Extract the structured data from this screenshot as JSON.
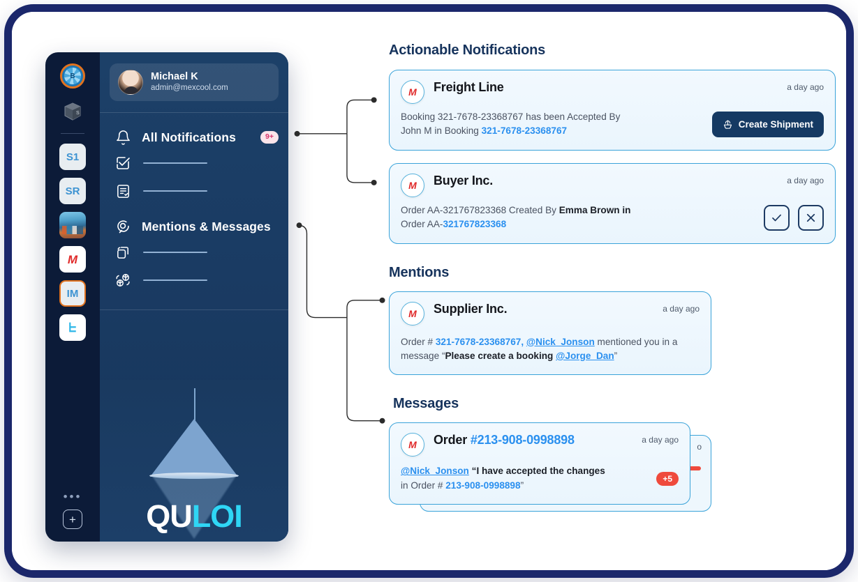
{
  "sidebar": {
    "rail": {
      "logo_icon": "quloi-rail-logo-icon",
      "logo_letter": "B",
      "box_icon": "package-box-icon",
      "tiles": [
        {
          "label": "S1",
          "name": "rail-tile-s1"
        },
        {
          "label": "SR",
          "name": "rail-tile-sr"
        },
        {
          "label": "",
          "name": "rail-tile-port-photo"
        },
        {
          "label": "M",
          "name": "rail-tile-m-logo"
        },
        {
          "label": "IM",
          "name": "rail-tile-im"
        },
        {
          "label": "P",
          "name": "rail-tile-p-logo"
        }
      ],
      "more_dots": "•••",
      "add_label": "+"
    },
    "profile": {
      "name": "Michael K",
      "email": "admin@mexcool.com"
    },
    "menu": {
      "all_notifications": {
        "label": "All Notifications",
        "badge": "9+",
        "icon": "bell-icon"
      },
      "sub_items_1": [
        {
          "icon": "check-square-icon"
        },
        {
          "icon": "document-check-icon"
        }
      ],
      "mentions_messages": {
        "label": "Mentions & Messages",
        "icon": "chat-bubble-icon"
      },
      "sub_items_2": [
        {
          "icon": "copy-pages-icon"
        },
        {
          "icon": "cube-refresh-icon"
        }
      ]
    },
    "brand": {
      "word_part1": "QU",
      "word_part2": "LOI",
      "lamp_icon": "pendant-lamp-icon"
    }
  },
  "content": {
    "sections": {
      "actionable": "Actionable Notifications",
      "mentions": "Mentions",
      "messages": "Messages"
    },
    "actionable_cards": [
      {
        "avatar_icon": "company-m-logo-icon",
        "title": "Freight Line",
        "time": "a day ago",
        "text_line1_pre": "Booking 321-7678-23368767 has been Accepted By",
        "text_line2_pre": "John M in Booking ",
        "text_line2_link": "321-7678-23368767",
        "action_button": "Create Shipment",
        "action_button_icon": "ship-icon"
      },
      {
        "avatar_icon": "company-m-logo-icon",
        "title": "Buyer Inc.",
        "time": "a day ago",
        "text_line1_pre": "Order AA-321767823368 Created By ",
        "text_line1_bold": "Emma Brown in",
        "text_line2_pre": "Order AA-",
        "text_line2_link": "321767823368",
        "accept_icon": "check-icon",
        "reject_icon": "close-x-icon"
      }
    ],
    "mention_card": {
      "avatar_icon": "company-m-logo-icon",
      "title": "Supplier Inc.",
      "time": "a day ago",
      "text_pre": "Order # ",
      "order_link": "321-7678-23368767,",
      "user_link": "@Nick_Jonson",
      "text_mid": " mentioned you in a message ",
      "quote_open": "“",
      "quote_bold": "Please create a booking ",
      "quote_link": "@Jorge_Dan",
      "quote_close": "”"
    },
    "message_card": {
      "avatar_icon": "company-m-logo-icon",
      "title_prefix": "Order ",
      "title_order": "#213-908-0998898",
      "time": "a day ago",
      "user_link": "@Nick_Jonson",
      "quote_line1": "“I have accepted the changes",
      "quote_line2_pre": "in Order # ",
      "quote_line2_link": "213-908-0998898",
      "quote_close": "”",
      "badge": "+5",
      "behind_time": "o",
      "behind_badge": ""
    }
  },
  "colors": {
    "frame_border": "#1b276b",
    "rail_bg": "#0c1b38",
    "menu_bg": "#194069",
    "accent_blue": "#2b90ef",
    "card_border": "#3aa3d9",
    "heading": "#16335c",
    "primary_button": "#153a63",
    "badge_red": "#ef4a3c",
    "badge_pink_bg": "#fbe4ea",
    "badge_pink_text": "#d6336c",
    "brand_cyan": "#2fd6f5",
    "orange_ring": "#e2731f"
  }
}
